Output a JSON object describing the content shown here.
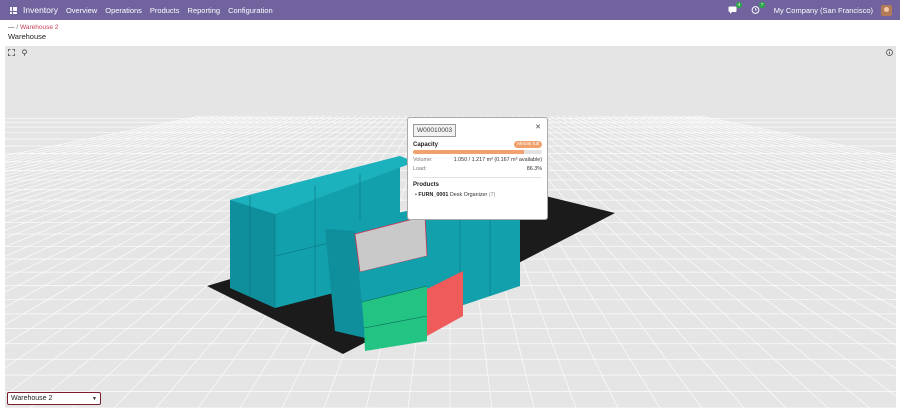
{
  "navbar": {
    "brand": "Inventory",
    "menu": [
      "Overview",
      "Operations",
      "Products",
      "Reporting",
      "Configuration"
    ],
    "messages_count": "4",
    "activities_count": "7",
    "company": "My Company (San Francisco)"
  },
  "breadcrumb": {
    "separator": "/",
    "link": "Warehouse 2"
  },
  "page_title": "Warehouse",
  "popover": {
    "location_id": "W00010003",
    "capacity_label": "Capacity",
    "status_badge": "Almost full",
    "fill_percent": 86.3,
    "volume_label": "Volume:",
    "volume_value": "1.050 / 1.217 m³ (0.167 m³ available)",
    "load_label": "Load:",
    "load_value": "86.3%",
    "products_label": "Products",
    "product_code": "FURN_0001",
    "product_name": "Desk Organizer",
    "product_qty": "(7)"
  },
  "warehouse_select": {
    "value": "Warehouse 2"
  },
  "colors": {
    "navbar": "#71639e",
    "teal": "#1a9fad",
    "green": "#27c487",
    "red": "#ef5b5b",
    "accent": "#c43d55"
  },
  "icons": [
    "apps-icon",
    "chat-icon",
    "clock-icon",
    "fullscreen-icon",
    "pin-icon",
    "info-icon",
    "close-icon",
    "chevron-down-icon"
  ]
}
